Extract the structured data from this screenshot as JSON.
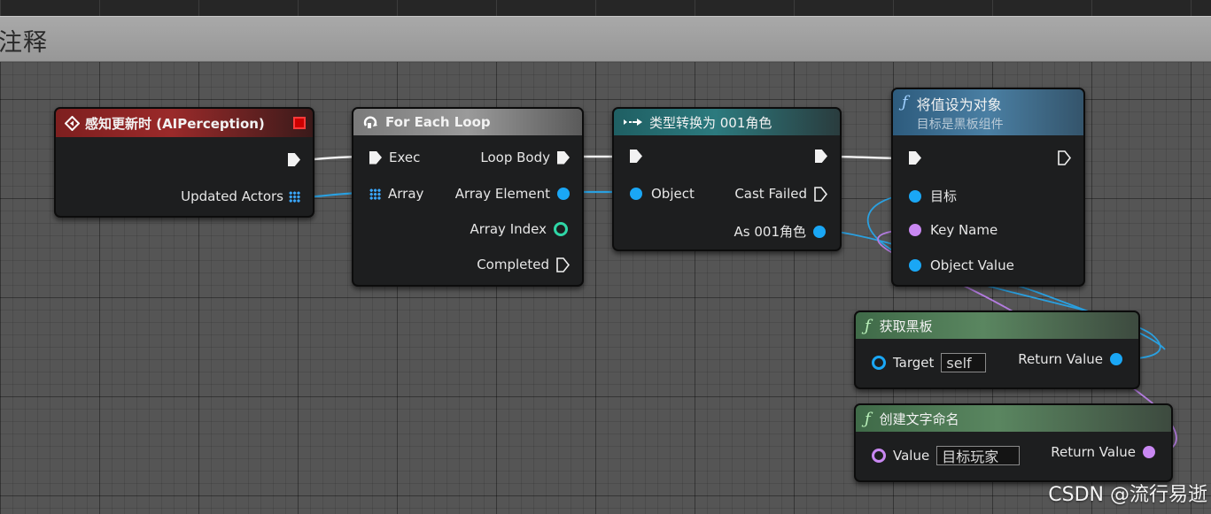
{
  "comment": {
    "title": "注释"
  },
  "nodes": {
    "perception": {
      "title": "感知更新时 (AIPerception)",
      "pins_out": {
        "updated_actors": "Updated Actors"
      }
    },
    "foreach": {
      "title": "For Each Loop",
      "pins_in": {
        "exec": "Exec",
        "array": "Array"
      },
      "pins_out": {
        "loop_body": "Loop Body",
        "array_element": "Array Element",
        "array_index": "Array Index",
        "completed": "Completed"
      }
    },
    "cast": {
      "title": "类型转换为 001角色",
      "pins_in": {
        "object": "Object"
      },
      "pins_out": {
        "cast_failed": "Cast Failed",
        "as_role": "As 001角色"
      }
    },
    "set_value": {
      "title": "将值设为对象",
      "subtitle": "目标是黑板组件",
      "pins_in": {
        "target": "目标",
        "key_name": "Key Name",
        "object_value": "Object Value"
      }
    },
    "get_blackboard": {
      "title": "获取黑板",
      "pins_in": {
        "target": "Target",
        "target_default": "self"
      },
      "pins_out": {
        "return_value": "Return Value"
      }
    },
    "make_literal": {
      "title": "创建文字命名",
      "pins_in": {
        "value": "Value",
        "value_default": "目标玩家"
      },
      "pins_out": {
        "return_value": "Return Value"
      }
    }
  },
  "colors": {
    "exec": "#f2f2f2",
    "object_pin": "#1aa7f5",
    "name_pin": "#c988f2",
    "int_pin": "#2fd6a6",
    "event_header": "#9a2a2a",
    "function_header": "#4a7fa3",
    "pure_header": "#5a8660",
    "cast_header": "#2c7a7e"
  },
  "watermark": "CSDN @流行易逝"
}
